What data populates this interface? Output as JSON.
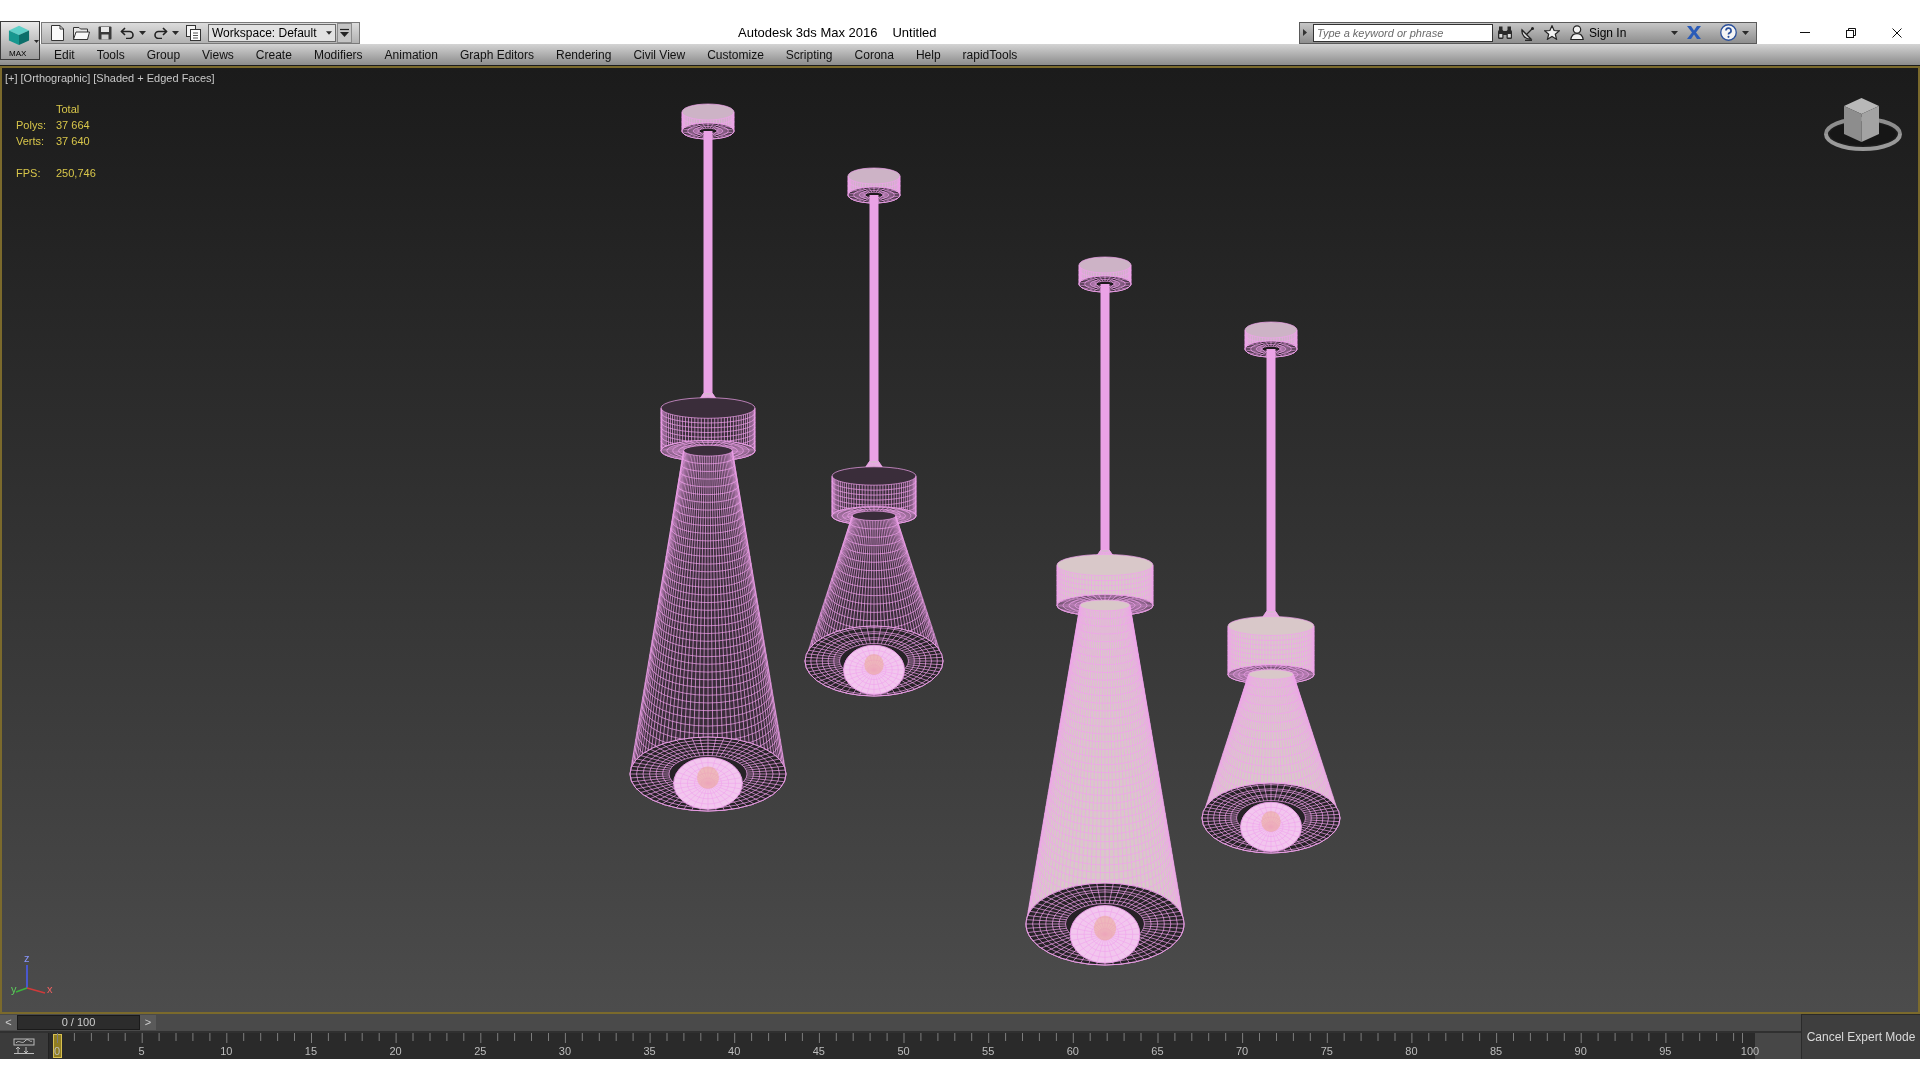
{
  "app_button": {
    "label": "MAX"
  },
  "quick_access": {
    "workspace": "Workspace: Default"
  },
  "title": {
    "app": "Autodesk 3ds Max 2016",
    "document": "Untitled"
  },
  "search": {
    "placeholder": "Type a keyword or phrase",
    "sign_in": "Sign In"
  },
  "menu": [
    "Edit",
    "Tools",
    "Group",
    "Views",
    "Create",
    "Modifiers",
    "Animation",
    "Graph Editors",
    "Rendering",
    "Civil View",
    "Customize",
    "Scripting",
    "Corona",
    "Help",
    "rapidTools"
  ],
  "viewport": {
    "labels": [
      "[+]",
      "[Orthographic]",
      "[Shaded + Edged Faces]"
    ],
    "stats": {
      "heading": "Total",
      "rows": [
        {
          "label": "Polys:",
          "value": "37 664"
        },
        {
          "label": "Verts:",
          "value": "37 640"
        }
      ],
      "fps": {
        "label": "FPS:",
        "value": "250,746"
      }
    },
    "axis_labels": [
      "z",
      "y",
      "x"
    ]
  },
  "time_slider": {
    "prev": "<",
    "reading": "0 / 100",
    "next": ">",
    "level": 0
  },
  "trackbar": {
    "labels": [
      "0",
      "5",
      "10",
      "15",
      "20",
      "25",
      "30",
      "35",
      "40",
      "45",
      "50",
      "55",
      "60",
      "65",
      "70",
      "75",
      "80",
      "85",
      "90",
      "95",
      "100"
    ]
  },
  "expert_mode_button": "Cancel Expert Mode"
}
